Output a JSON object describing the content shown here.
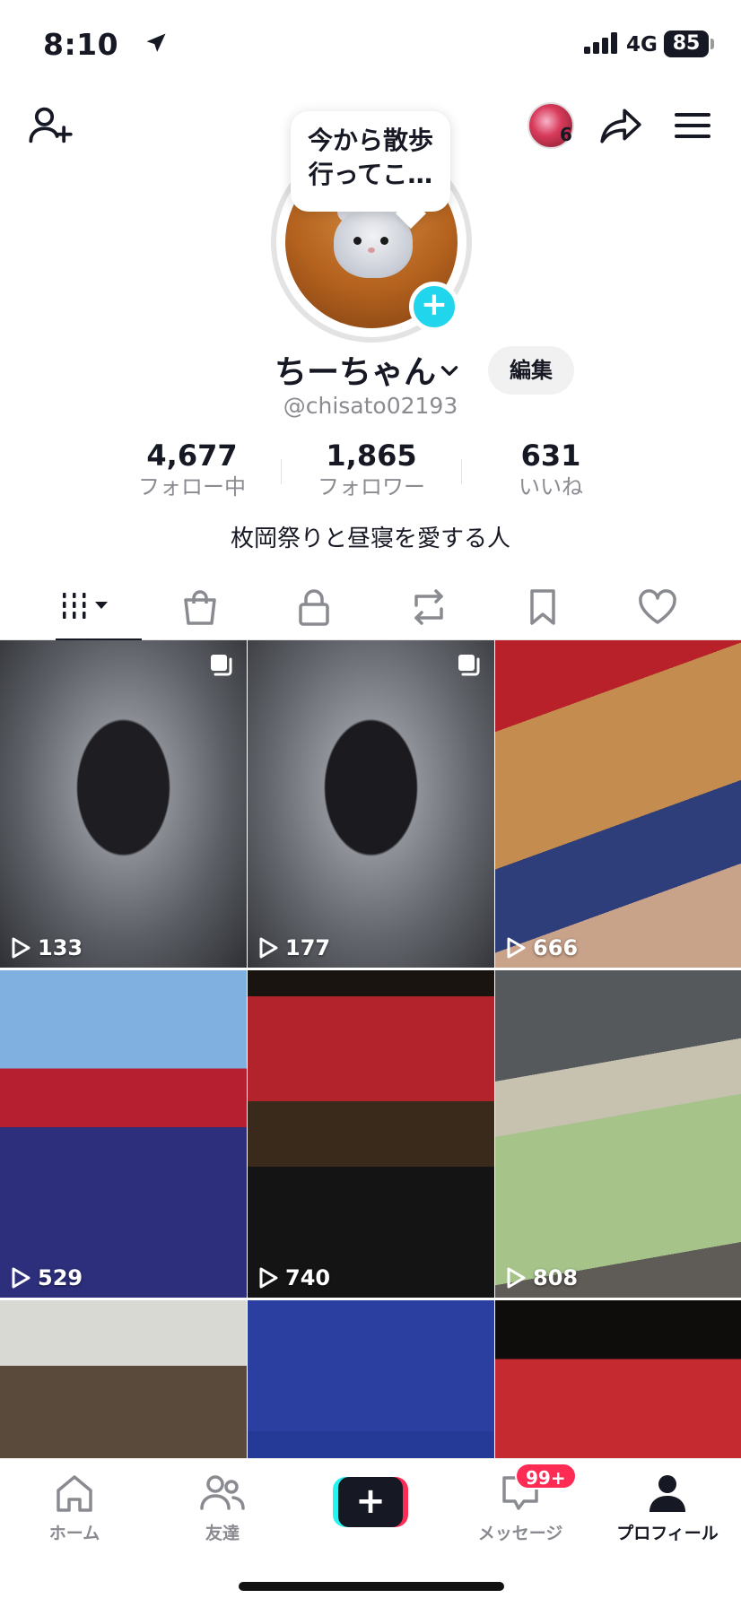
{
  "status_bar": {
    "time": "8:10",
    "network": "4G",
    "battery": "85"
  },
  "top_bar": {
    "story_count": "6"
  },
  "profile": {
    "status_bubble": "今から散歩行ってこ…",
    "display_name": "ちーちゃん",
    "edit_label": "編集",
    "handle": "@chisato02193",
    "bio": "枚岡祭りと昼寝を愛する人"
  },
  "stats": [
    {
      "value": "4,677",
      "label": "フォロー中"
    },
    {
      "value": "1,865",
      "label": "フォロワー"
    },
    {
      "value": "631",
      "label": "いいね"
    }
  ],
  "tabs": [
    "videos",
    "shop",
    "private",
    "reposts",
    "favorites",
    "liked"
  ],
  "videos": [
    {
      "views": "133",
      "multi": true
    },
    {
      "views": "177",
      "multi": true
    },
    {
      "views": "666",
      "multi": false
    },
    {
      "views": "529",
      "multi": false
    },
    {
      "views": "740",
      "multi": false
    },
    {
      "views": "808",
      "multi": false
    },
    {
      "views": "",
      "multi": false
    },
    {
      "views": "",
      "multi": false
    },
    {
      "views": "",
      "multi": false
    }
  ],
  "bottom_nav": {
    "home": "ホーム",
    "friends": "友達",
    "messages": "メッセージ",
    "messages_badge": "99+",
    "profile": "プロフィール"
  },
  "colors": {
    "accent_cyan": "#25f4ee",
    "accent_red": "#fe2c55",
    "avatar_plus": "#20d5ec"
  }
}
